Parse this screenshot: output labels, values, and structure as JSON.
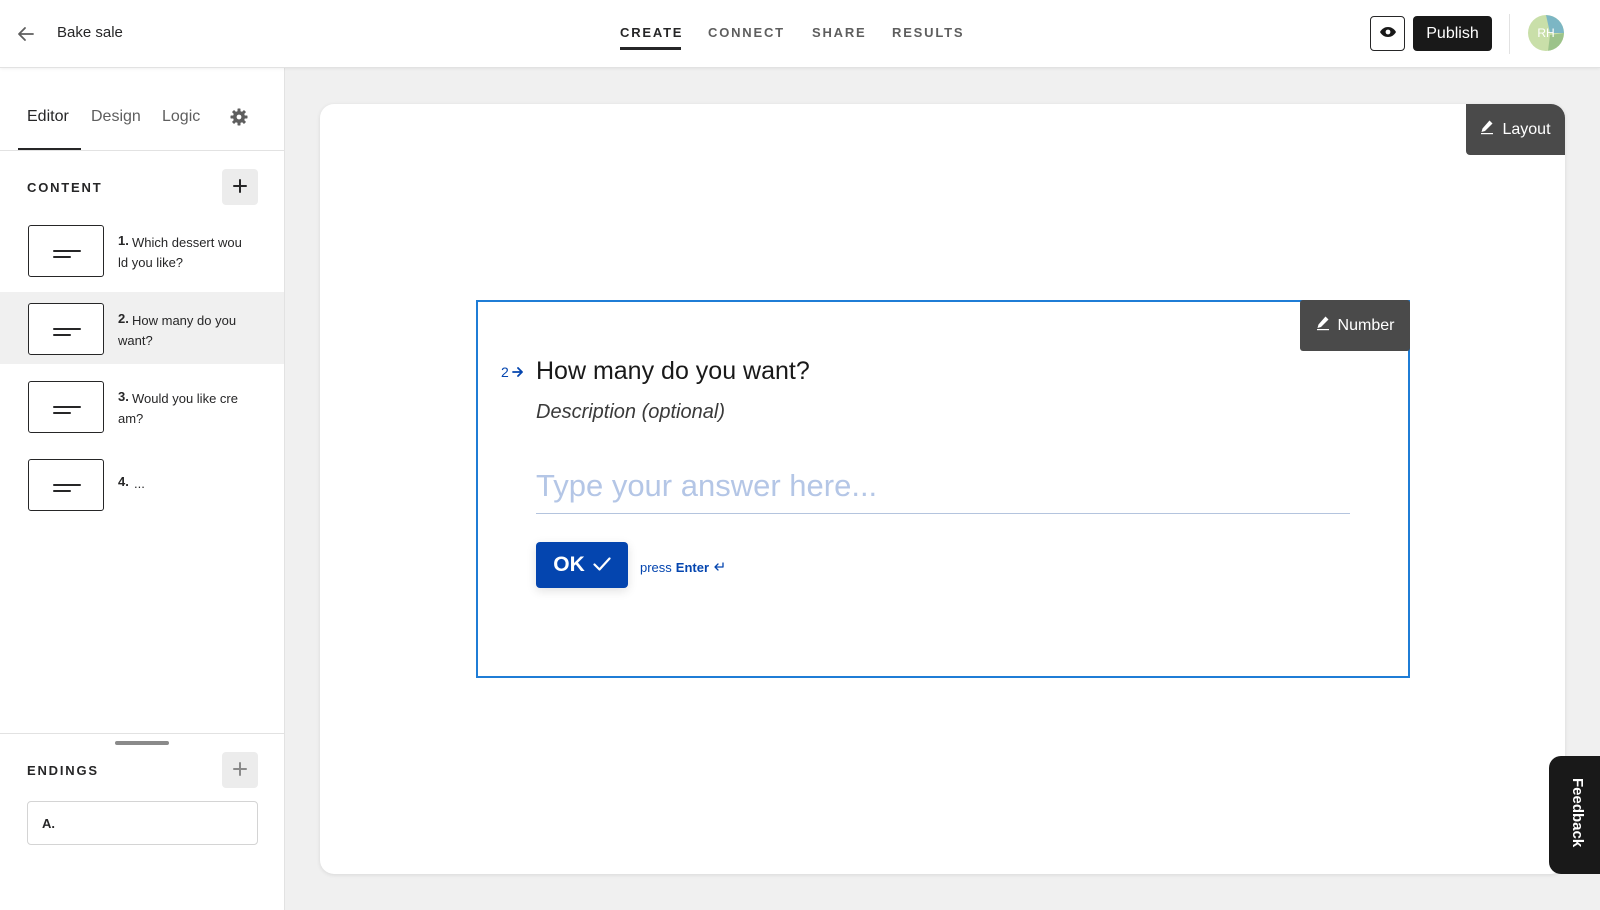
{
  "header": {
    "form_title": "Bake sale",
    "nav_tabs": [
      "CREATE",
      "CONNECT",
      "SHARE",
      "RESULTS"
    ],
    "active_tab": "CREATE",
    "publish_label": "Publish",
    "avatar_initials": "RH"
  },
  "sidebar": {
    "tabs": [
      "Editor",
      "Design",
      "Logic"
    ],
    "active_tab": "Editor",
    "content_title": "CONTENT",
    "questions": [
      {
        "number": "1.",
        "label": "Which dessert would you like?"
      },
      {
        "number": "2.",
        "label": "How many do you want?"
      },
      {
        "number": "3.",
        "label": "Would you like cream?"
      },
      {
        "number": "4.",
        "label": "..."
      }
    ],
    "selected_question": 2,
    "endings_title": "ENDINGS",
    "endings": [
      {
        "label": "A."
      }
    ]
  },
  "canvas": {
    "layout_label": "Layout",
    "question_type_label": "Number",
    "question_index": "2",
    "question_title": "How many do you want?",
    "description_placeholder": "Description (optional)",
    "answer_placeholder": "Type your answer here...",
    "ok_label": "OK",
    "press_hint_prefix": "press",
    "press_hint_key": "Enter"
  },
  "feedback_label": "Feedback",
  "colors": {
    "accent_blue": "#0445af",
    "selection_border": "#1f7dd6",
    "dark_button": "#191919",
    "type_badge": "#4a4a4a"
  },
  "icons": [
    "back-arrow-icon",
    "eye-icon",
    "gear-icon",
    "plus-icon",
    "pencil-icon",
    "arrow-right-icon",
    "check-icon",
    "enter-key-icon",
    "short-text-icon"
  ]
}
